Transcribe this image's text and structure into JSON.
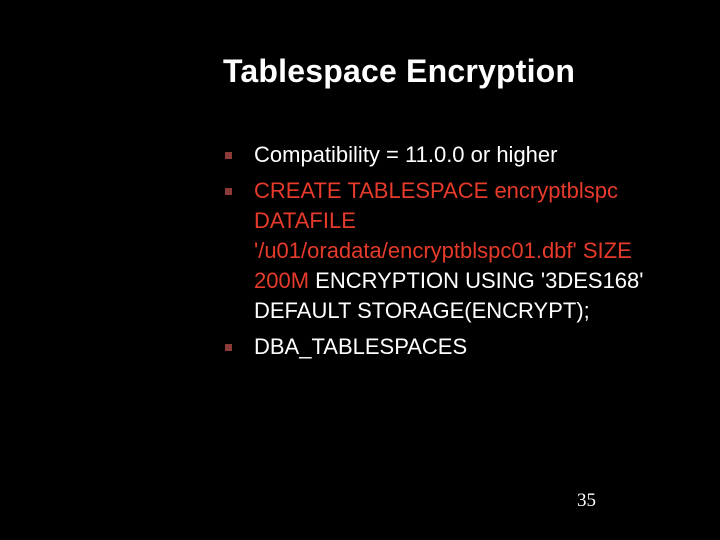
{
  "title": "Tablespace Encryption",
  "items": {
    "0": {
      "text": "Compatibility = 11.0.0 or higher"
    },
    "1": {
      "seg0": "CREATE TABLESPACE encryptblspc DATAFILE '/u01/oradata/encryptblspc01.dbf' SIZE 200M ",
      "seg1": "ENCRYPTION USING '3DES168' DEFAULT STORAGE(ENCRYPT);"
    },
    "2": {
      "text": "DBA_TABLESPACES"
    }
  },
  "page_number": "35"
}
